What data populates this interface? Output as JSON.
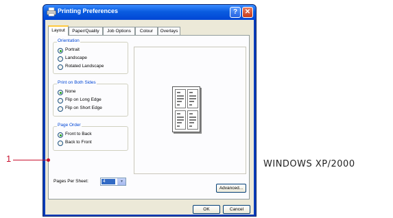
{
  "window": {
    "title": "Printing Preferences",
    "help_label": "?",
    "close_label": "✕",
    "icon": "printer-icon"
  },
  "tabs": [
    {
      "label": "Layout",
      "active": true
    },
    {
      "label": "Paper/Quality",
      "active": false
    },
    {
      "label": "Job Options",
      "active": false
    },
    {
      "label": "Colour",
      "active": false
    },
    {
      "label": "Overlays",
      "active": false
    }
  ],
  "orientation": {
    "legend": "Orientation",
    "options": [
      {
        "label": "Portrait",
        "selected": true
      },
      {
        "label": "Landscape",
        "selected": false
      },
      {
        "label": "Rotated Landscape",
        "selected": false
      }
    ]
  },
  "duplex": {
    "legend": "Print on Both Sides",
    "options": [
      {
        "label": "None",
        "selected": true
      },
      {
        "label": "Flip on Long Edge",
        "selected": false
      },
      {
        "label": "Flip on Short Edge",
        "selected": false
      }
    ]
  },
  "page_order": {
    "legend": "Page Order",
    "options": [
      {
        "label": "Front to Back",
        "selected": true
      },
      {
        "label": "Back to Front",
        "selected": false
      }
    ]
  },
  "pages_per_sheet": {
    "label": "Pages Per Sheet:",
    "value": "4",
    "arrow": "▾"
  },
  "buttons": {
    "advanced": "Advanced...",
    "ok": "OK",
    "cancel": "Cancel"
  },
  "callout": {
    "number": "1",
    "color": "#c8102e"
  },
  "caption": "WINDOWS XP/2000",
  "colors": {
    "titlebar": "#0a5ce0",
    "dialog_bg": "#ece9d8",
    "group_legend": "#0046d5",
    "selection": "#316ac5"
  }
}
